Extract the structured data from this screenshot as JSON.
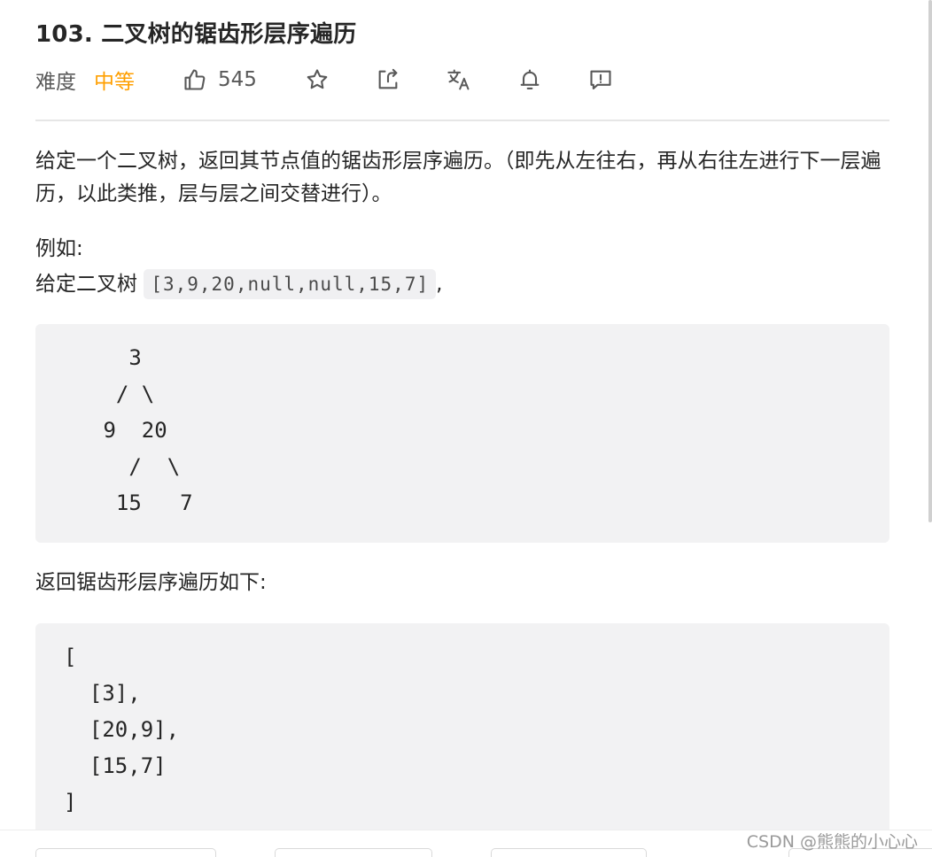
{
  "problem": {
    "title": "103. 二叉树的锯齿形层序遍历",
    "difficulty_label": "难度",
    "difficulty_value": "中等",
    "like_count": "545"
  },
  "icons": {
    "like": "thumbs-up-icon",
    "favorite": "star-icon",
    "share": "share-icon",
    "translate": "translate-icon",
    "notify": "bell-icon",
    "feedback": "feedback-icon"
  },
  "colors": {
    "difficulty_medium": "#ff9f00",
    "code_bg": "#f2f2f3"
  },
  "description": {
    "para1": "给定一个二叉树，返回其节点值的锯齿形层序遍历。（即先从左往右，再从右往左进行下一层遍历，以此类推，层与层之间交替进行）。",
    "example_label": "例如:",
    "given_prefix": "给定二叉树",
    "given_code": "[3,9,20,null,null,15,7]",
    "given_suffix": ",",
    "tree_lines": [
      "   3",
      "  / \\",
      " 9  20",
      "   /  \\",
      "  15   7"
    ],
    "return_label": "返回锯齿形层序遍历如下:",
    "result_lines": [
      "[",
      "  [3],",
      "  [20,9],",
      "  [15,7]",
      "]"
    ]
  },
  "watermark": "CSDN @熊熊的小心心"
}
